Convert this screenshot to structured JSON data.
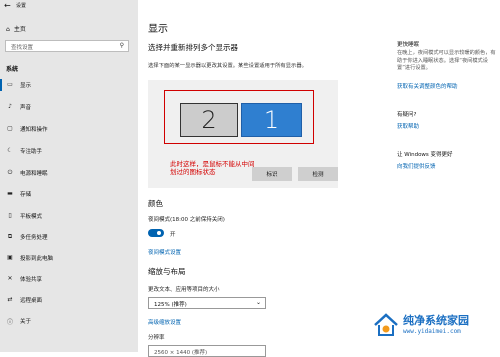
{
  "window": {
    "title": "设置",
    "back_icon": "back-arrow-icon"
  },
  "sidebar": {
    "home": "主页",
    "search_placeholder": "查找设置",
    "section": "系统",
    "items": [
      {
        "label": "显示",
        "icon": "monitor-icon"
      },
      {
        "label": "声音",
        "icon": "speaker-icon"
      },
      {
        "label": "通知和操作",
        "icon": "notification-icon"
      },
      {
        "label": "专注助手",
        "icon": "moon-icon"
      },
      {
        "label": "电源和睡眠",
        "icon": "power-icon"
      },
      {
        "label": "存储",
        "icon": "storage-icon"
      },
      {
        "label": "平板模式",
        "icon": "tablet-icon"
      },
      {
        "label": "多任务处理",
        "icon": "multitask-icon"
      },
      {
        "label": "投影到此电脑",
        "icon": "project-icon"
      },
      {
        "label": "体验共享",
        "icon": "share-icon"
      },
      {
        "label": "远程桌面",
        "icon": "remote-desktop-icon"
      },
      {
        "label": "关于",
        "icon": "info-icon"
      }
    ]
  },
  "main": {
    "title": "显示",
    "arrange_heading": "选择并重新排列多个显示器",
    "arrange_desc": "选择下面的某一显示器以更改其设置。某些设置适用于所有显示器。",
    "monitor_2": "2",
    "monitor_1": "1",
    "annotation": "此时这样，是鼠标不能从中间划过的图标状态",
    "identify_button": "标识",
    "detect_button": "检测",
    "color_heading": "颜色",
    "night_light_label": "夜间模式(18:00 之前保持关闭)",
    "night_light_state": "开",
    "night_light_on": true,
    "night_light_link": "夜间模式设置",
    "scale_heading": "缩放与布局",
    "scale_label": "更改文本、应用等项目的大小",
    "scale_value": "125% (推荐)",
    "advanced_scale_link": "高级缩放设置",
    "resolution_label": "分辨率",
    "resolution_value": "2560 × 1440 (推荐)"
  },
  "right": {
    "sleep_title": "更快睡眠",
    "sleep_text": "在晚上，夜间模式可以显示较暖的颜色，有助于你进入睡眠状态。选择“夜间模式设置”进行设置。",
    "sleep_link": "获取有关调整颜色的帮助",
    "question_title": "有疑问?",
    "help_link": "获取帮助",
    "improve_title": "让 Windows 变得更好",
    "feedback_link": "向我们提供反馈"
  },
  "watermark": {
    "name": "纯净系统家园",
    "url": "www.yidaimei.com",
    "colors": {
      "blue": "#1b6fc2",
      "orange": "#f39a1b"
    }
  },
  "colors": {
    "accent": "#0063b1",
    "selected_monitor": "#2f7fd0",
    "annotation": "#d40000"
  }
}
